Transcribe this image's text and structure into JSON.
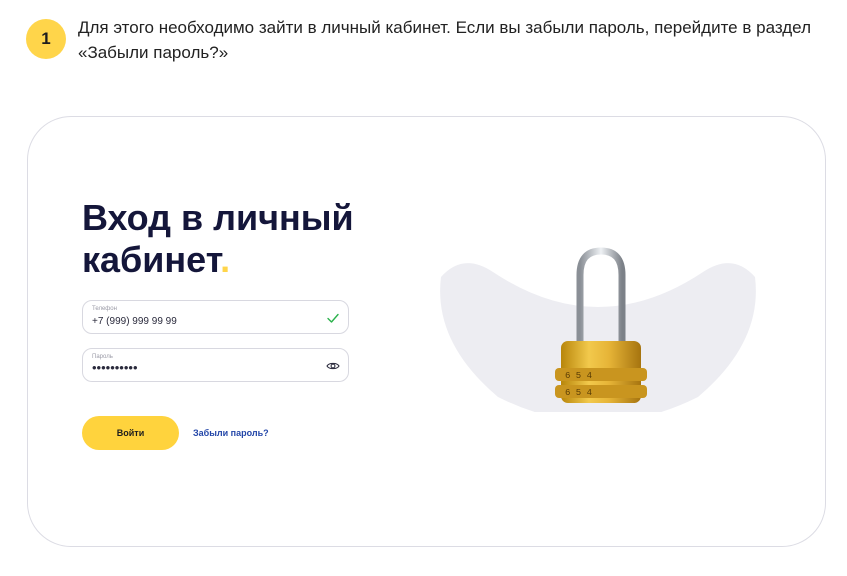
{
  "step": {
    "number": "1",
    "text": "Для этого необходимо зайти в личный кабинет. Если вы забыли пароль, перейдите в раздел «Забыли пароль?»"
  },
  "login": {
    "title_line1": "Вход в личный",
    "title_line2": "кабинет",
    "title_dot": ".",
    "phone_label": "Телефон",
    "phone_value": "+7 (999) 999 99 99",
    "password_label": "Пароль",
    "password_value": "••••••••••",
    "submit_label": "Войти",
    "forgot_label": "Забыли пароль?"
  },
  "icons": {
    "phone_valid": "check-icon",
    "password_toggle": "eye-icon",
    "illustration": "padlock-icon"
  },
  "colors": {
    "accent_yellow": "#ffd33d",
    "title_navy": "#14163a",
    "link_blue": "#2346a8",
    "check_green": "#2bb24c"
  }
}
